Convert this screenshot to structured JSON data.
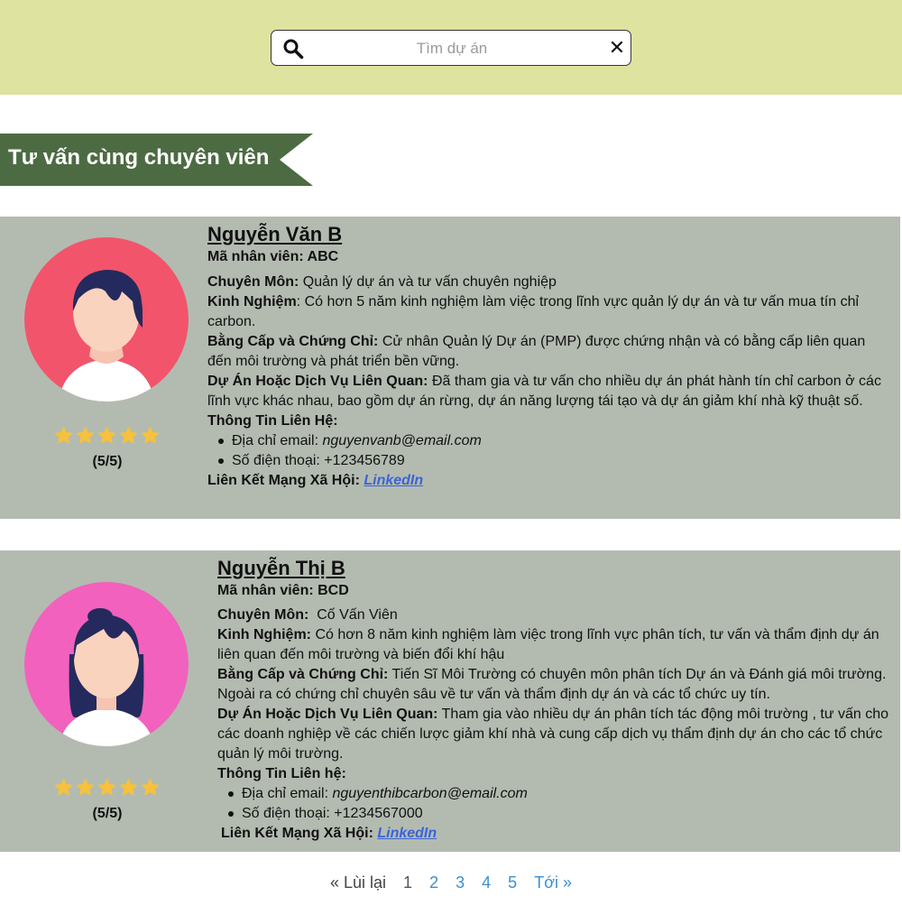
{
  "search": {
    "placeholder": "Tìm dự án"
  },
  "section_title": "Tư vấn cùng chuyên viên",
  "colors": {
    "topbar": "#dee3a0",
    "banner": "#4d6b43",
    "card": "#b3bbb0",
    "star": "#f7c13b",
    "link": "#3b64d8",
    "avatar1_bg": "#f2546c",
    "avatar2_bg": "#f261bd"
  },
  "experts": [
    {
      "name": "Nguyễn Văn B",
      "id_label": "Mã nhân viên: ABC",
      "specialty_label": "Chuyên Môn:",
      "specialty_value": " Quản lý dự án và tư vấn chuyên nghiệp",
      "experience_label": "Kinh Nghiệm",
      "experience_value": ": Có hơn 5 năm kinh nghiệm làm việc trong lĩnh vực quản lý dự án và tư vấn mua tín chỉ carbon.",
      "degree_label": "Bằng Cấp và Chứng Chỉ:",
      "degree_value": " Cử nhân Quản lý Dự án (PMP) được chứng nhận và có bằng cấp liên quan đến môi trường và phát triển bền vững.",
      "projects_label": "Dự Án Hoặc Dịch Vụ Liên Quan:",
      "projects_value": " Đã tham gia và tư vấn cho nhiều dự án phát hành tín chỉ carbon ở các lĩnh vực khác nhau, bao gồm dự án rừng, dự án năng lượng tái tạo và dự án giảm khí nhà kỹ thuật số.",
      "contact_label": "Thông Tin Liên Hệ:",
      "email_label": "Địa chỉ email: ",
      "email_value": "nguyenvanb@email.com",
      "phone": "Số điện thoại: +123456789",
      "social_label": "Liên Kết Mạng Xã Hội: ",
      "social_link": "LinkedIn",
      "rating": 5,
      "score": "(5/5)"
    },
    {
      "name": "Nguyễn Thị B",
      "id_label": "Mã nhân viên: BCD",
      "specialty_label": "Chuyên Môn:",
      "specialty_value": "  Cố Vấn Viên",
      "experience_label": "Kinh Nghiệm:",
      "experience_value": " Có hơn 8 năm kinh nghiệm làm việc trong lĩnh vực phân tích, tư vấn và thẩm định dự án liên quan đến môi trường và biến đổi khí hậu",
      "degree_label": "Bằng Cấp và Chứng Chỉ:",
      "degree_value": " Tiến Sĩ Môi Trường có chuyên môn phân tích Dự án và Đánh giá môi trường. Ngoài ra có chứng chỉ chuyên sâu về tư vấn và thẩm định dự án và các tổ chức uy tín.",
      "projects_label": "Dự Án Hoặc Dịch Vụ Liên Quan:",
      "projects_value": " Tham gia vào nhiều dự án phân tích tác động môi trường , tư vấn cho các doanh nghiệp về các chiến lược giảm khí nhà và cung cấp dịch vụ thẩm định dự án cho các tổ chức quản lý môi trường.",
      "contact_label": "Thông Tin Liên hệ:",
      "email_label": "Địa chỉ email: ",
      "email_value": "nguyenthibcarbon@email.com",
      "phone": "Số điện thoại: +1234567000",
      "social_label": "Liên Kết Mạng Xã Hội: ",
      "social_link": "LinkedIn",
      "rating": 5,
      "score": "(5/5)"
    }
  ],
  "pagination": {
    "prev": "« Lùi lại",
    "pages": [
      "1",
      "2",
      "3",
      "4",
      "5"
    ],
    "current": "1",
    "next": "Tới »"
  }
}
